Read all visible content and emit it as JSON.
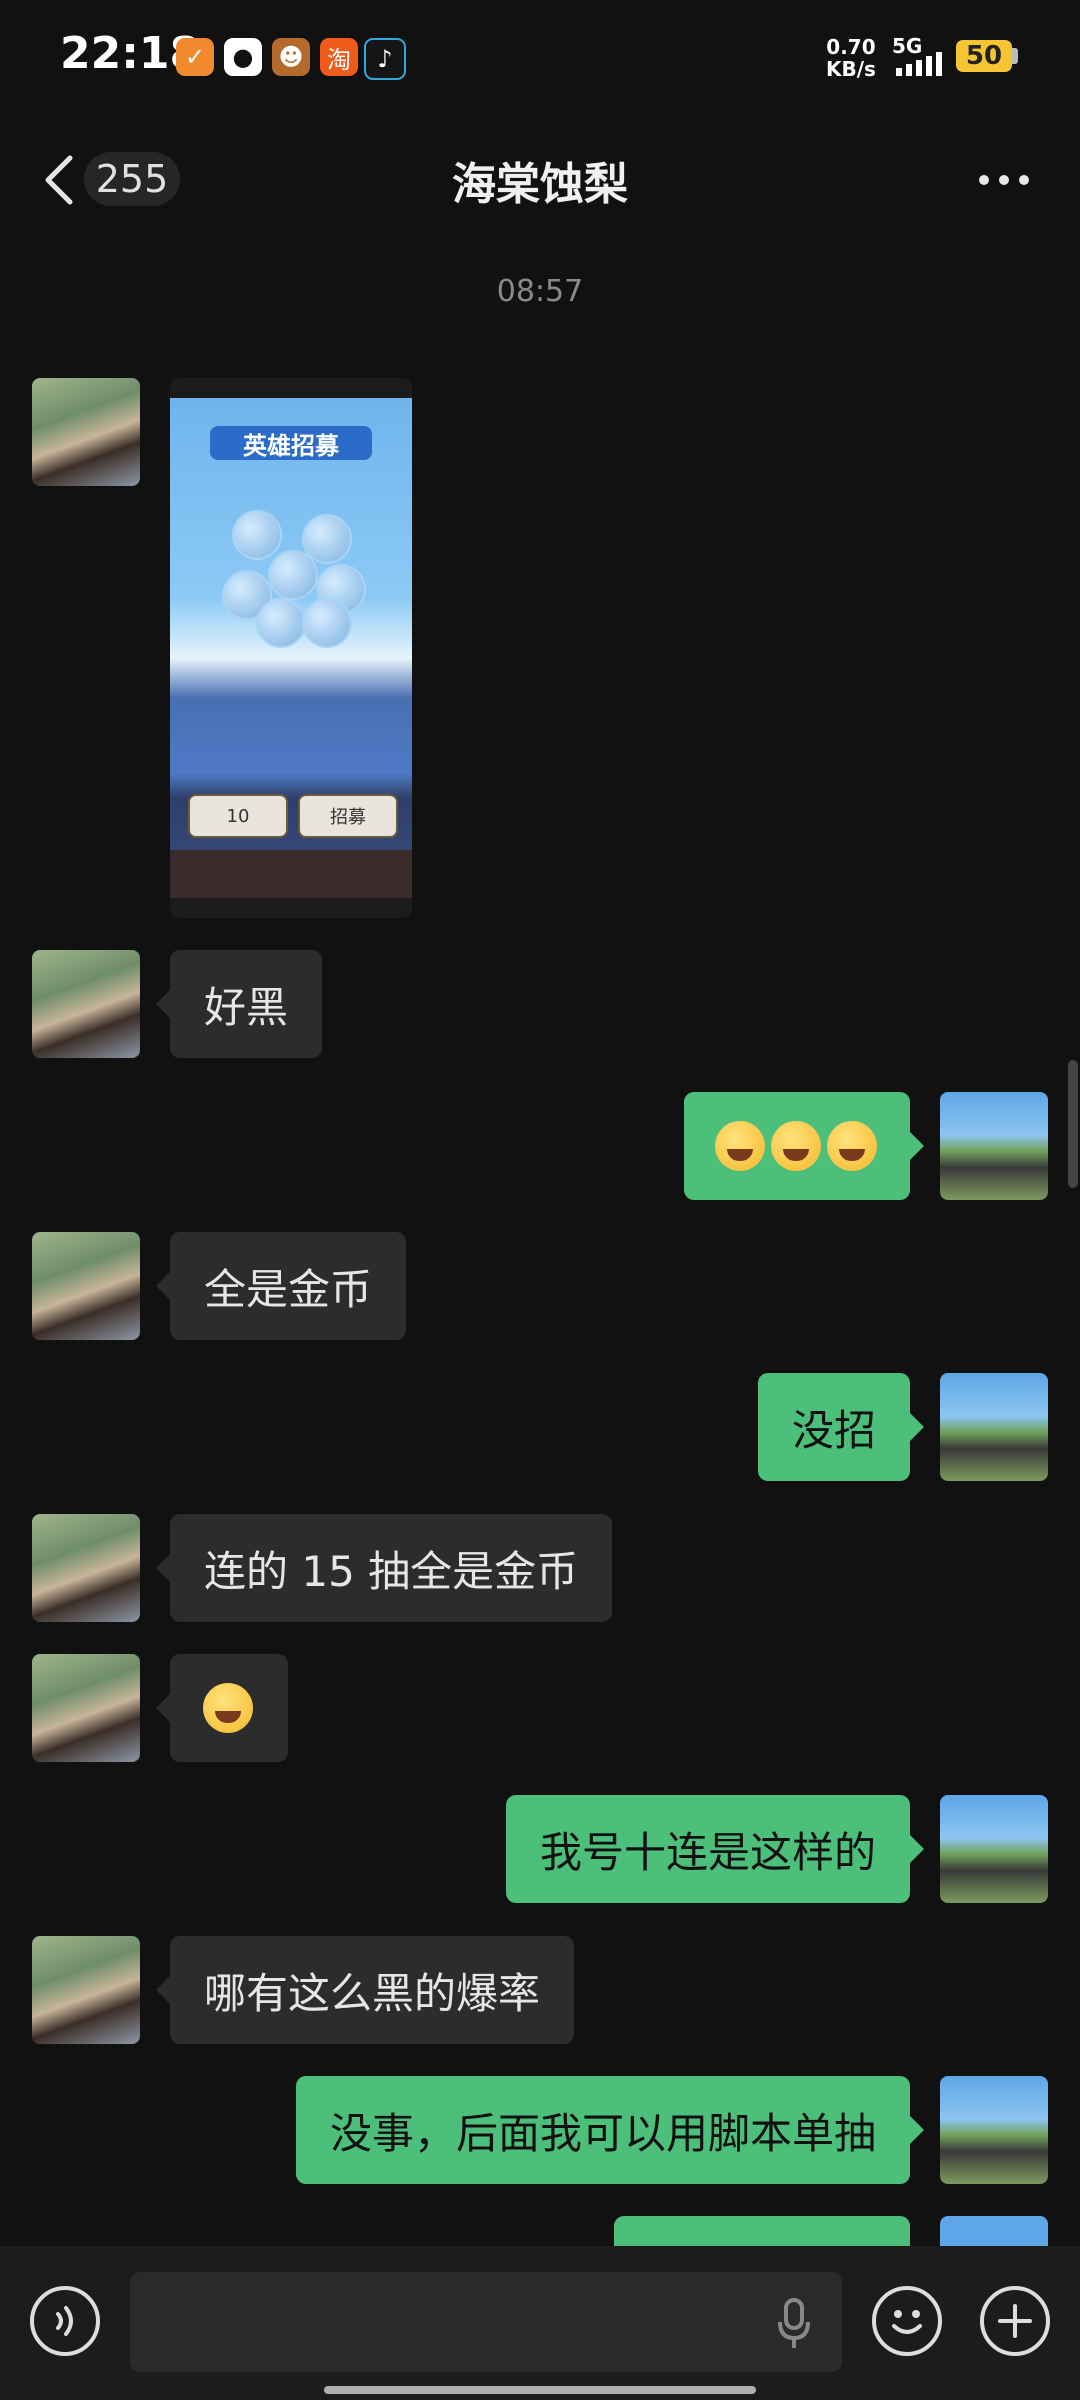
{
  "status_bar": {
    "time": "22:18",
    "app_icons": [
      "app-icon-orange",
      "qq-icon",
      "game-icon",
      "taobao-icon",
      "tiktok-icon"
    ],
    "net_speed_value": "0.70",
    "net_speed_unit": "KB/s",
    "signal_label": "5G",
    "battery": "50"
  },
  "header": {
    "back_count": "255",
    "title": "海棠蚀梨"
  },
  "timestamp": "08:57",
  "messages": [
    {
      "side": "in",
      "type": "image"
    },
    {
      "side": "in",
      "text": "好黑"
    },
    {
      "side": "out",
      "type": "emoji",
      "emoji": "laughing-tears-emoji x3"
    },
    {
      "side": "in",
      "text": "全是金币"
    },
    {
      "side": "out",
      "text": "没招"
    },
    {
      "side": "in",
      "text": "连的 15 抽全是金币"
    },
    {
      "side": "in",
      "type": "emoji",
      "emoji": "broken-face-emoji"
    },
    {
      "side": "out",
      "text": "我号十连是这样的"
    },
    {
      "side": "in",
      "text": "哪有这么黑的爆率"
    },
    {
      "side": "out",
      "text": "没事，后面我可以用脚本单抽"
    }
  ],
  "image_message": {
    "title": "英雄招募",
    "btn_left": "10",
    "btn_right": "招募"
  },
  "colors": {
    "background": "#111111",
    "incoming_bubble": "#2c2c2c",
    "outgoing_bubble": "#4cc07a",
    "battery": "#f5c533"
  }
}
